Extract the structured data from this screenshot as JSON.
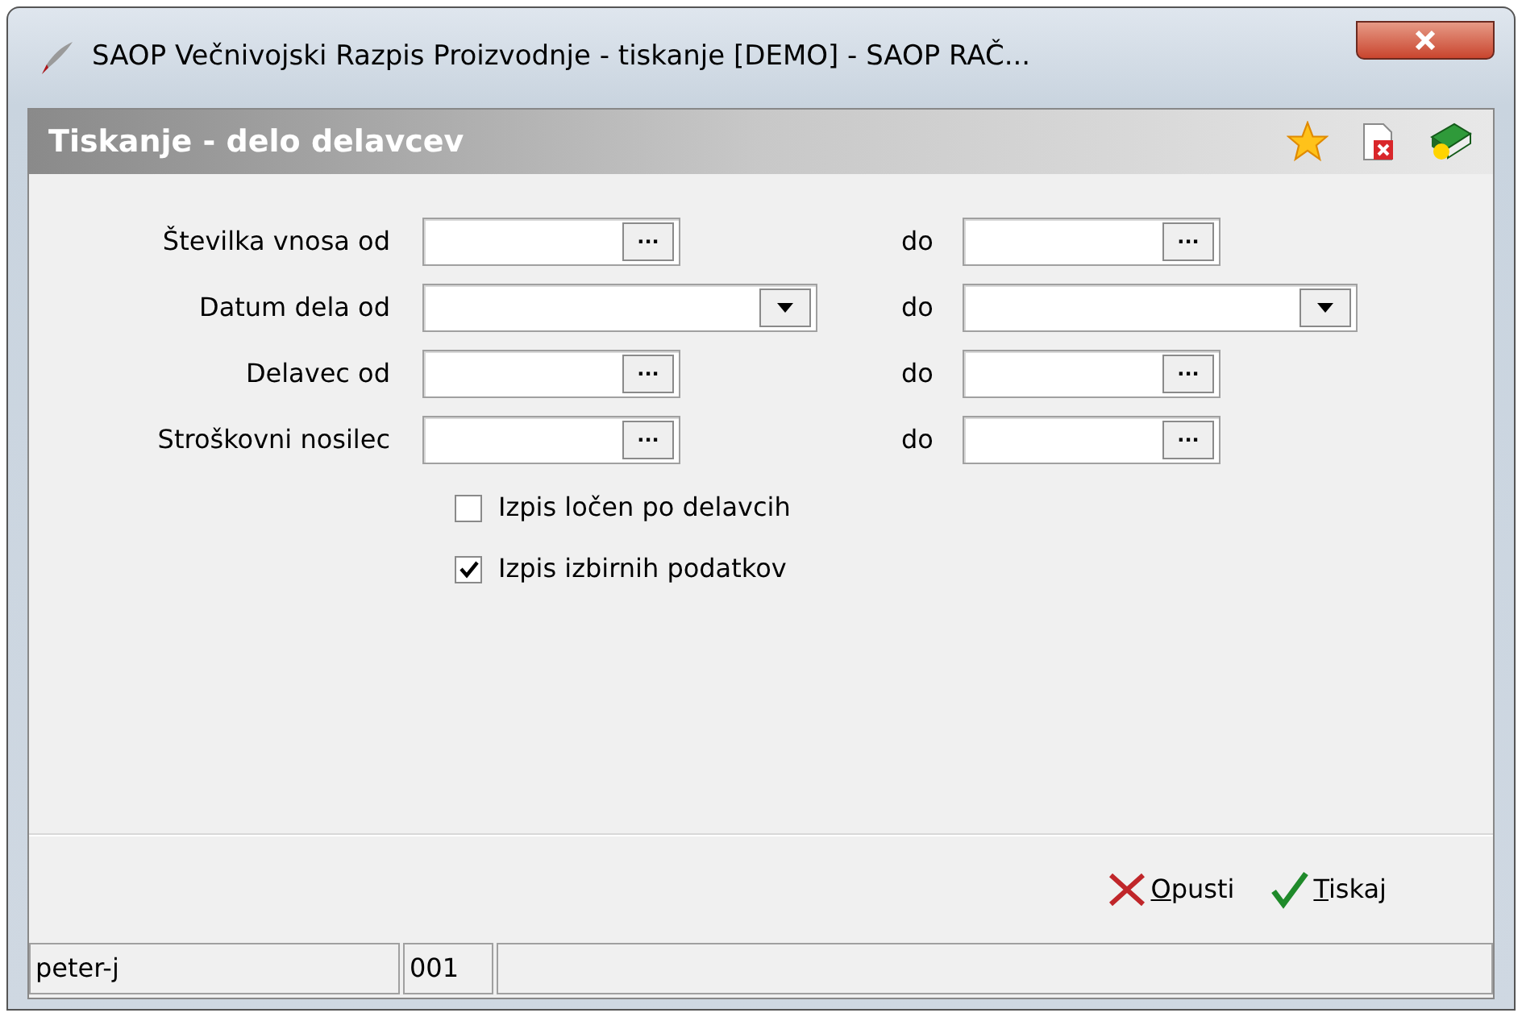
{
  "window": {
    "title": "SAOP   Večnivojski Razpis Proizvodnje - tiskanje [DEMO] - SAOP RAČ..."
  },
  "header": {
    "title": "Tiskanje - delo delavcev"
  },
  "rows": [
    {
      "label": "Številka vnosa od",
      "kind": "picker",
      "to_label": "do"
    },
    {
      "label": "Datum dela od",
      "kind": "dropdown",
      "to_label": "do"
    },
    {
      "label": "Delavec od",
      "kind": "picker",
      "to_label": "do"
    },
    {
      "label": "Stroškovni nosilec",
      "kind": "picker",
      "to_label": "do"
    }
  ],
  "picker_button": "···",
  "checkboxes": [
    {
      "label": "Izpis ločen po delavcih",
      "checked": false
    },
    {
      "label": "Izpis izbirnih podatkov",
      "checked": true
    }
  ],
  "buttons": [
    {
      "label": "Opusti",
      "kind": "cancel"
    },
    {
      "label": "Tiskaj",
      "kind": "ok"
    }
  ],
  "status_bar": [
    "peter-j",
    "001"
  ]
}
